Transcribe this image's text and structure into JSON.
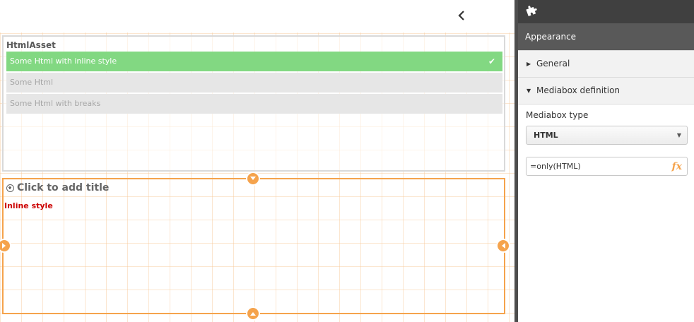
{
  "sheet": {
    "back_icon": "chevron-left-icon"
  },
  "listbox": {
    "title": "HtmlAsset",
    "items": [
      {
        "label": "Some Html with inline style",
        "state": "selected"
      },
      {
        "label": "Some Html",
        "state": "alternative"
      },
      {
        "label": "Some Html with breaks",
        "state": "alternative"
      }
    ],
    "check_icon": "checkmark-icon"
  },
  "mediabox": {
    "title_placeholder": "Click to add title",
    "content": "Inline style",
    "content_color": "#cc0000"
  },
  "panel": {
    "header_icon": "puzzle-icon",
    "section": "Appearance",
    "accordion": {
      "general": "General",
      "mediabox_definition": "Mediabox definition"
    },
    "mediabox_type_label": "Mediabox type",
    "mediabox_type_value": "HTML",
    "expression_value": "=only(HTML)",
    "fx_label": "fx"
  },
  "colors": {
    "selected_green": "#82d882",
    "accent_orange": "#f5a34c",
    "panel_dark": "#404040",
    "section_gray": "#595959"
  }
}
